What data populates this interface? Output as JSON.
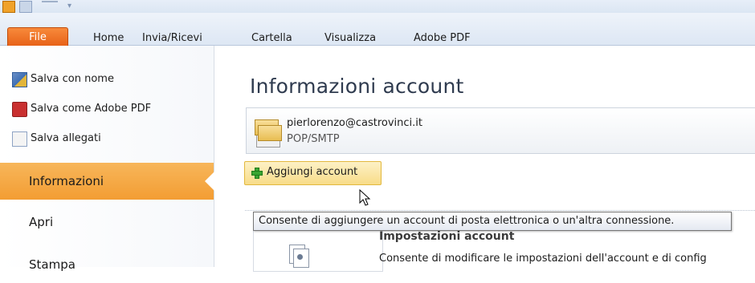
{
  "tabs": {
    "file": "File",
    "home": "Home",
    "invia": "Invia/Ricevi",
    "cartella": "Cartella",
    "visualizza": "Visualizza",
    "adobe": "Adobe PDF"
  },
  "backstage": {
    "commands": {
      "save_as": "Salva con nome",
      "save_pdf": "Salva come Adobe PDF",
      "save_attachments": "Salva allegati"
    },
    "nav": {
      "info": "Informazioni",
      "open": "Apri",
      "print": "Stampa"
    }
  },
  "info": {
    "title": "Informazioni account",
    "account_email": "pierlorenzo@castrovinci.it",
    "account_type": "POP/SMTP",
    "add_account": "Aggiungi account",
    "tooltip": "Consente di aggiungere un account di posta elettronica o un'altra connessione.",
    "settings_title": "Impostazioni account",
    "settings_desc": "Consente di modificare le impostazioni dell'account e di config"
  },
  "icons": {
    "app": "outlook-app-icon",
    "save": "save-icon",
    "undo": "undo-icon",
    "save_as": "save-as-icon",
    "pdf": "pdf-icon",
    "attachments": "attachments-icon",
    "account": "account-cards-icon",
    "add": "green-plus-icon",
    "settings": "account-settings-icon",
    "cursor": "mouse-pointer-icon"
  },
  "colors": {
    "file_tab": "#e45b12",
    "active_nav": "#f39d33",
    "add_button": "#f8dc88"
  }
}
